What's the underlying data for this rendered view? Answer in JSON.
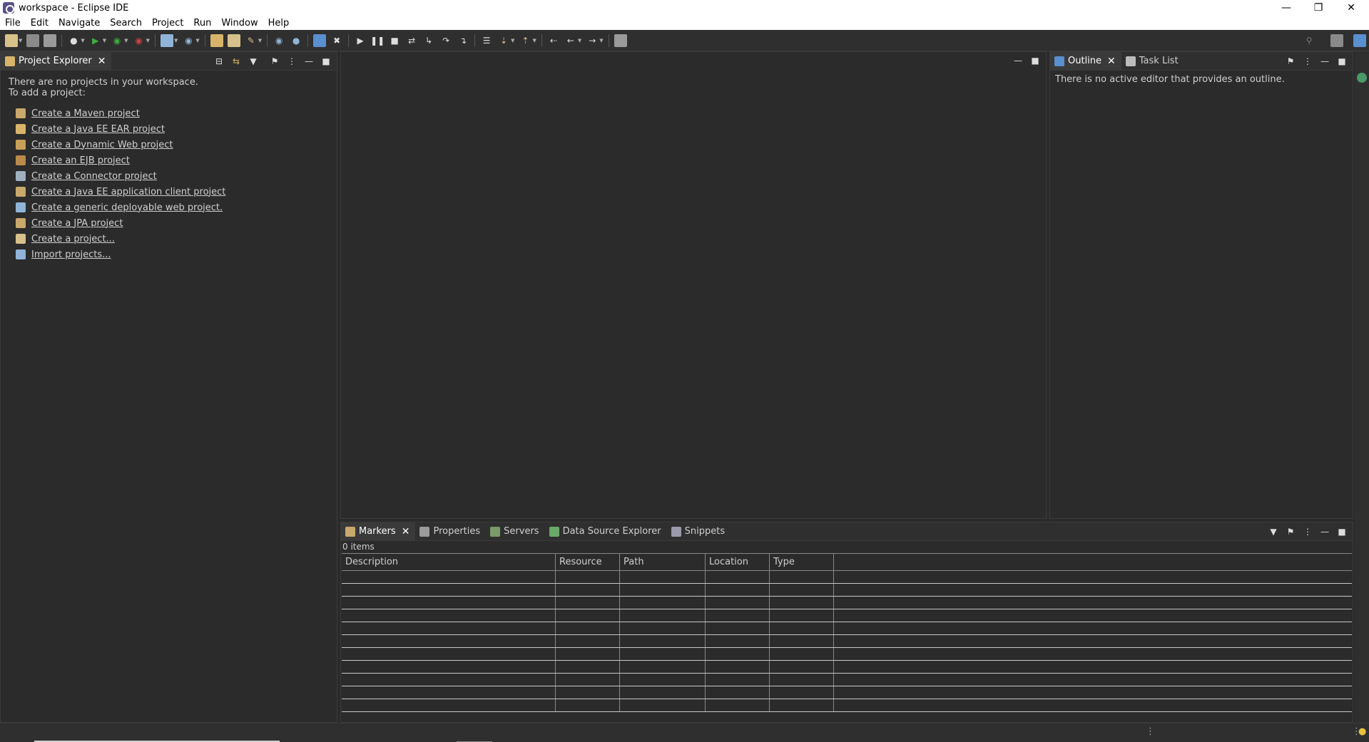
{
  "window": {
    "title": "workspace - Eclipse IDE",
    "controls": [
      "minimize-icon",
      "restore-icon",
      "close-icon"
    ]
  },
  "menu": {
    "items": [
      "File",
      "Edit",
      "Navigate",
      "Search",
      "Project",
      "Run",
      "Window",
      "Help"
    ]
  },
  "project_explorer": {
    "tab_label": "Project Explorer",
    "message_line1": "There are no projects in your workspace.",
    "message_line2": "To add a project:",
    "links": [
      {
        "label": "Create a Maven project",
        "icon": "maven-project-icon",
        "color": "#c9a86b"
      },
      {
        "label": "Create a Java EE EAR project",
        "icon": "ear-project-icon",
        "color": "#d8b46a"
      },
      {
        "label": "Create a Dynamic Web project",
        "icon": "web-project-icon",
        "color": "#c8a05a"
      },
      {
        "label": "Create an EJB project",
        "icon": "ejb-project-icon",
        "color": "#b98a4a"
      },
      {
        "label": "Create a Connector project",
        "icon": "connector-project-icon",
        "color": "#a0b0c0"
      },
      {
        "label": "Create a Java EE application client project",
        "icon": "app-client-project-icon",
        "color": "#c9a86b"
      },
      {
        "label": "Create a generic deployable web project.",
        "icon": "deployable-web-project-icon",
        "color": "#8fb4d8"
      },
      {
        "label": "Create a JPA project",
        "icon": "jpa-project-icon",
        "color": "#c9a86b"
      },
      {
        "label": "Create a project...",
        "icon": "new-project-icon",
        "color": "#d8c08a"
      },
      {
        "label": "Import projects...",
        "icon": "import-icon",
        "color": "#8fb4d8"
      }
    ]
  },
  "outline": {
    "tabs": [
      {
        "label": "Outline",
        "active": true
      },
      {
        "label": "Task List",
        "active": false
      }
    ],
    "message": "There is no active editor that provides an outline."
  },
  "bottom_panel": {
    "tabs": [
      {
        "label": "Markers",
        "active": true
      },
      {
        "label": "Properties",
        "active": false
      },
      {
        "label": "Servers",
        "active": false
      },
      {
        "label": "Data Source Explorer",
        "active": false
      },
      {
        "label": "Snippets",
        "active": false
      }
    ],
    "count": "0 items",
    "columns": [
      "Description",
      "Resource",
      "Path",
      "Location",
      "Type"
    ]
  },
  "colors": {
    "background": "#2b2b2b",
    "panel_header": "#2f2f2f",
    "menubar": "#ffffff",
    "text": "#cfcfcf"
  }
}
